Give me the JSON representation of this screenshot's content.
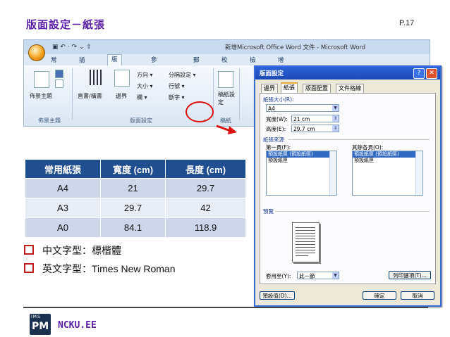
{
  "slide": {
    "title": "版面設定－紙張",
    "page_number": "P.17"
  },
  "ribbon": {
    "window_title": "新增Microsoft Office Word 文件 - Microsoft Word",
    "quick_access": "▣ ↶ · ↷ ⌄ ⇧",
    "tabs": [
      "常用",
      "插入",
      "版面配置",
      "參考資料",
      "郵件",
      "校閱",
      "檢視",
      "增益集"
    ],
    "active_tab": "版面配置",
    "controls": {
      "theme": "佈景主題",
      "direction": "直書/橫書",
      "margins": "邊界",
      "orientation": "方向 ▾",
      "size": "大小 ▾",
      "columns": "欄 ▾",
      "breaks": "分隔設定 ▾",
      "line_numbers": "行號 ▾",
      "hyphenation": "斷字 ▾",
      "manuscript": "稿紙設定"
    },
    "groups": {
      "theme": "佈景主題",
      "page_setup": "版面設定",
      "manuscript": "稿紙"
    }
  },
  "dialog": {
    "title": "版面設定",
    "help": "?",
    "close": "✕",
    "tabs": [
      "邊界",
      "紙張",
      "版面配置",
      "文件格線"
    ],
    "active_tab": "紙張",
    "paper_size_section": "紙張大小(R):",
    "paper_size_value": "A4",
    "width_label": "寬度(W):",
    "width_value": "21 cm",
    "height_label": "高度(E):",
    "height_value": "29.7 cm",
    "paper_source_section": "紙張來源",
    "first_page_label": "第一頁(F):",
    "other_pages_label": "其餘各頁(O):",
    "first_page_items": [
      "預設紙匣 (預設紙匣)",
      "預設紙匣"
    ],
    "other_pages_items": [
      "預設紙匣 (預設紙匣)",
      "預設紙匣"
    ],
    "preview_section": "預覽",
    "apply_to_label": "套用至(Y):",
    "apply_to_value": "此一節",
    "print_options_button": "列印選項(T)...",
    "default_button": "預設值(D)...",
    "ok_button": "確定",
    "cancel_button": "取消"
  },
  "table": {
    "headers": [
      "常用紙張",
      "寬度 (cm)",
      "長度 (cm)"
    ],
    "rows": [
      [
        "A4",
        "21",
        "29.7"
      ],
      [
        "A3",
        "29.7",
        "42"
      ],
      [
        "A0",
        "84.1",
        "118.9"
      ]
    ]
  },
  "bullets": [
    {
      "label": "中文字型：",
      "value": "標楷體"
    },
    {
      "label": "英文字型：",
      "value": "Times New Roman"
    }
  ],
  "footer": {
    "logo_top": "IMS",
    "logo_main": "PM",
    "org": "NCKU.EE"
  },
  "colors": {
    "title": "#5a1fa8",
    "table_header": "#1f4f8f",
    "bullet_box": "#c01a1a",
    "highlight_circle": "#e01010"
  }
}
